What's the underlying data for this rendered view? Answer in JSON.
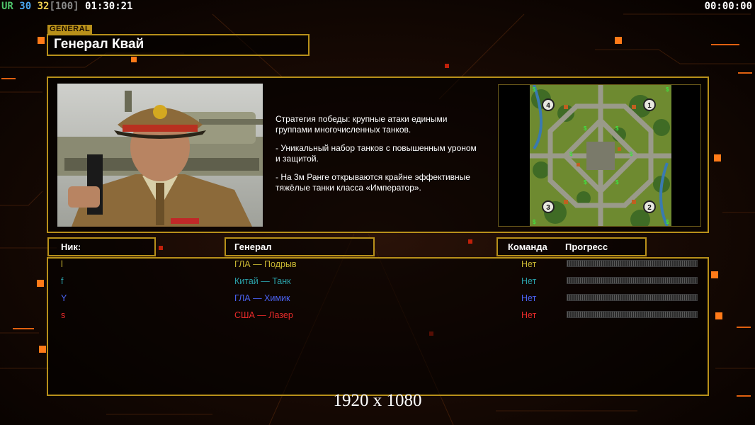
{
  "hud": {
    "ur": "UR",
    "n30": "30",
    "n32": "32",
    "cap": "[100]",
    "clock": "01:30:21",
    "timer": "00:00:00"
  },
  "general_tag": "GENERAL",
  "title": "Генерал Квай",
  "strategy": [
    "Стратегия победы: крупные атаки едиными\n группами многочисленных танков.",
    "- Уникальный набор танков с повышенным уроном\n  и защитой.",
    "- На 3м Ранге открываются крайне эффективные\n  тяжёлые танки класса «Император»."
  ],
  "headers": {
    "nick": "Ник:",
    "general": "Генерал",
    "team": "Команда",
    "progress": "Прогресс"
  },
  "players": [
    {
      "nick": "l",
      "general": "ГЛА — Подрыв",
      "team": "Нет",
      "color": "#c9b632"
    },
    {
      "nick": "f",
      "general": "Китай — Танк",
      "team": "Нет",
      "color": "#2aa0a8"
    },
    {
      "nick": "Y",
      "general": "ГЛА — Химик",
      "team": "Нет",
      "color": "#4a62f0"
    },
    {
      "nick": "s",
      "general": "США — Лазер",
      "team": "Нет",
      "color": "#e82a2a"
    }
  ],
  "minimap": {
    "start_positions": [
      "4",
      "1",
      "3",
      "2"
    ],
    "resource_marker": "$"
  },
  "resolution": "1920 x 1080",
  "colors": {
    "accent_gold": "#b8901a",
    "background": "#0d0502",
    "glow_orange": "#ff6a10"
  }
}
